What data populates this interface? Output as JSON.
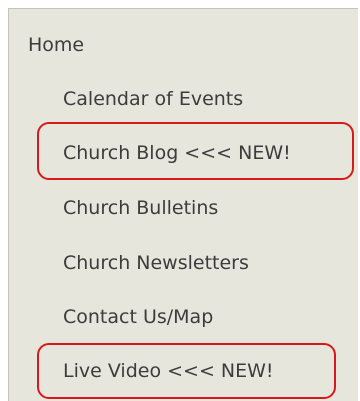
{
  "nav": {
    "items": [
      {
        "label": "Home"
      },
      {
        "label": "Calendar of Events"
      },
      {
        "label": "Church Blog <<< NEW!"
      },
      {
        "label": "Church Bulletins"
      },
      {
        "label": "Church Newsletters"
      },
      {
        "label": "Contact Us/Map"
      },
      {
        "label": "Live Video <<< NEW!"
      }
    ]
  },
  "colors": {
    "panel_background": "#e6e6dd",
    "text": "#3c3c3c",
    "highlight": "#d61a1a"
  }
}
